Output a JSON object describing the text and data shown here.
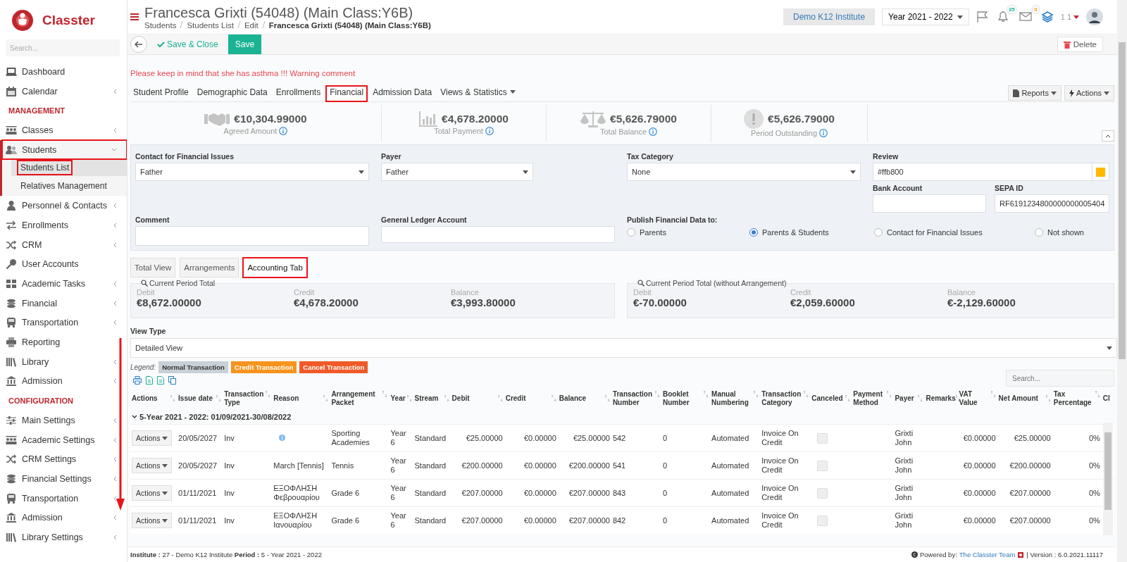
{
  "brand": {
    "name": "Classter"
  },
  "sidebar": {
    "search": {
      "placeholder": "Search..."
    },
    "items": [
      {
        "kind": "link",
        "label": "Dashboard",
        "highlighted": false
      },
      {
        "kind": "group",
        "label": "Calendar",
        "expanded": false,
        "highlighted": false
      },
      {
        "kind": "section",
        "label": "MANAGEMENT"
      },
      {
        "kind": "group",
        "label": "Classes",
        "expanded": false,
        "highlighted": false
      },
      {
        "kind": "group",
        "label": "Students",
        "expanded": true,
        "highlighted": true,
        "children": [
          {
            "label": "Students List",
            "selected": true,
            "highlighted": true
          },
          {
            "label": "Relatives Management",
            "selected": false,
            "highlighted": false
          }
        ]
      },
      {
        "kind": "group",
        "label": "Personnel & Contacts",
        "expanded": false,
        "highlighted": false
      },
      {
        "kind": "group",
        "label": "Enrollments",
        "expanded": false,
        "highlighted": false
      },
      {
        "kind": "group",
        "label": "CRM",
        "expanded": false,
        "highlighted": false
      },
      {
        "kind": "link",
        "label": "User Accounts",
        "highlighted": false
      },
      {
        "kind": "group",
        "label": "Academic Tasks",
        "expanded": false,
        "highlighted": false
      },
      {
        "kind": "group",
        "label": "Financial",
        "expanded": false,
        "highlighted": false
      },
      {
        "kind": "group",
        "label": "Transportation",
        "expanded": false,
        "highlighted": false
      },
      {
        "kind": "link",
        "label": "Reporting",
        "highlighted": false
      },
      {
        "kind": "group",
        "label": "Library",
        "expanded": false,
        "highlighted": false
      },
      {
        "kind": "group",
        "label": "Admission",
        "expanded": false,
        "highlighted": false
      },
      {
        "kind": "section",
        "label": "CONFIGURATION"
      },
      {
        "kind": "group",
        "label": "Main Settings",
        "expanded": false,
        "highlighted": false
      },
      {
        "kind": "group",
        "label": "Academic Settings",
        "expanded": false,
        "highlighted": false
      },
      {
        "kind": "group",
        "label": "CRM Settings",
        "expanded": false,
        "highlighted": false
      },
      {
        "kind": "group",
        "label": "Financial Settings",
        "expanded": false,
        "highlighted": false
      },
      {
        "kind": "group",
        "label": "Transportation",
        "expanded": false,
        "highlighted": false
      },
      {
        "kind": "group",
        "label": "Admission",
        "expanded": false,
        "highlighted": false
      },
      {
        "kind": "group",
        "label": "Library Settings",
        "expanded": false,
        "highlighted": false
      }
    ]
  },
  "header": {
    "title": "Francesca Grixti (54048) (Main Class:Y6B)",
    "breadcrumb": [
      "Students",
      "Students List",
      "Edit",
      "Francesca Grixti (54048) (Main Class:Y6B)"
    ],
    "institute": "Demo K12 Institute",
    "year": "Year 2021 - 2022",
    "notifications": "35",
    "messages": "0",
    "user": "1 1"
  },
  "toolbar": {
    "save_close": "Save & Close",
    "save": "Save",
    "delete": "Delete"
  },
  "warning": "Please keep in mind that she has asthma !!! Warning comment",
  "tabs": [
    {
      "label": "Student Profile",
      "selected": false,
      "highlighted": false
    },
    {
      "label": "Demographic Data",
      "selected": false,
      "highlighted": false
    },
    {
      "label": "Enrollments",
      "selected": false,
      "highlighted": false
    },
    {
      "label": "Financial",
      "selected": true,
      "highlighted": true
    },
    {
      "label": "Admission Data",
      "selected": false,
      "highlighted": false
    },
    {
      "label": "Views & Statistics",
      "selected": false,
      "highlighted": false,
      "dropdown": true
    }
  ],
  "tab_actions": [
    "Reports",
    "Actions"
  ],
  "summary": [
    {
      "amount": "€10,304.99000",
      "label": "Agreed Amount"
    },
    {
      "amount": "€4,678.20000",
      "label": "Total Payment"
    },
    {
      "amount": "€5,626.79000",
      "label": "Total Balance"
    },
    {
      "amount": "€5,626.79000",
      "label": "Period Outstanding"
    }
  ],
  "form": {
    "contact": {
      "label": "Contact for Financial Issues",
      "value": "Father"
    },
    "payer": {
      "label": "Payer",
      "value": "Father"
    },
    "tax_category": {
      "label": "Tax Category",
      "value": "None"
    },
    "review": {
      "label": "Review",
      "value": "#ffb800",
      "color": "#ffb800"
    },
    "bank_account": {
      "label": "Bank Account"
    },
    "sepa_id": {
      "label": "SEPA ID",
      "value": "RF6191234800000000005404"
    },
    "comment": {
      "label": "Comment"
    },
    "general_ledger": {
      "label": "General Ledger Account"
    },
    "publish": {
      "label": "Publish Financial Data to:",
      "options": [
        {
          "label": "Parents",
          "selected": false
        },
        {
          "label": "Parents & Students",
          "selected": true
        },
        {
          "label": "Contact for Financial Issues",
          "selected": false
        },
        {
          "label": "Not shown",
          "selected": false
        }
      ]
    }
  },
  "subtabs": [
    {
      "label": "Total View",
      "selected": false,
      "highlighted": false
    },
    {
      "label": "Arrangements",
      "selected": false,
      "highlighted": false
    },
    {
      "label": "Accounting Tab",
      "selected": true,
      "highlighted": true
    }
  ],
  "totals": [
    {
      "title": "Current Period Total",
      "stats": [
        {
          "label": "Debit",
          "value": "€8,672.00000"
        },
        {
          "label": "Credit",
          "value": "€4,678.20000"
        },
        {
          "label": "Balance",
          "value": "€3,993.80000"
        }
      ]
    },
    {
      "title": "Current Period Total (without Arrangement)",
      "stats": [
        {
          "label": "Debit",
          "value": "€-70.00000"
        },
        {
          "label": "Credit",
          "value": "€2,059.60000"
        },
        {
          "label": "Balance",
          "value": "€-2,129.60000"
        }
      ]
    }
  ],
  "view_type": {
    "label": "View Type",
    "value": "Detailed View"
  },
  "legend": {
    "label": "Legend:",
    "items": [
      {
        "label": "Normal Transaction",
        "color": "#c9d0d6"
      },
      {
        "label": "Credit Transaction",
        "color": "#f7941d"
      },
      {
        "label": "Cancel Transaction",
        "color": "#f05a28"
      }
    ]
  },
  "table": {
    "search": {
      "placeholder": "Search..."
    },
    "columns": [
      "Actions",
      "Issue date",
      "Transaction Type",
      "Reason",
      "Arrangement Packet",
      "Year",
      "Stream",
      "Debit",
      "Credit",
      "Balance",
      "Transaction Number",
      "Booklet Number",
      "Manual Numbering",
      "Transaction Category",
      "Canceled",
      "Payment Method",
      "Payer",
      "Remarks",
      "VAT Value",
      "Net Amount",
      "Tax Percentage",
      "Cl"
    ],
    "group": {
      "label": "5-Year 2021 - 2022: 01/09/2021-30/08/2022",
      "expanded": true
    },
    "rows": [
      {
        "actions": "Actions",
        "issue_date": "20/05/2027",
        "type": "Inv",
        "info": true,
        "packet": "Sporting Academies",
        "year": "Year 6",
        "stream": "Standard",
        "debit": "€25.00000",
        "credit": "€0.00000",
        "balance": "€25.00000",
        "number": "542",
        "booklet": "0",
        "numbering": "Automated",
        "category": "Invoice On Credit",
        "canceled": false,
        "payer": "Grixti John",
        "vat": "€0.00000",
        "net": "€25.00000",
        "tax": "0%"
      },
      {
        "actions": "Actions",
        "issue_date": "20/05/2027",
        "type": "Inv",
        "reason": "March [Tennis]",
        "info": false,
        "packet": "Tennis",
        "year": "Year 6",
        "stream": "Standard",
        "debit": "€200.00000",
        "credit": "€0.00000",
        "balance": "€200.00000",
        "number": "541",
        "booklet": "0",
        "numbering": "Automated",
        "category": "Invoice On Credit",
        "canceled": false,
        "payer": "Grixti John",
        "vat": "€0.00000",
        "net": "€200.00000",
        "tax": "0%"
      },
      {
        "actions": "Actions",
        "issue_date": "01/11/2021",
        "type": "Inv",
        "reason": "ΕΞΟΦΛΗΣΗ Φεβρουαρίου",
        "info": false,
        "packet": "Grade 6",
        "year": "Year 6",
        "stream": "Standard",
        "debit": "€207.00000",
        "credit": "€0.00000",
        "balance": "€207.00000",
        "number": "843",
        "booklet": "0",
        "numbering": "Automated",
        "category": "Invoice On Credit",
        "canceled": false,
        "payer": "Grixti John",
        "vat": "€0.00000",
        "net": "€207.00000",
        "tax": "0%"
      },
      {
        "actions": "Actions",
        "issue_date": "01/11/2021",
        "type": "Inv",
        "reason": "ΕΞΟΦΛΗΣΗ Ιανουαρίου",
        "info": false,
        "packet": "Grade 6",
        "year": "Year 6",
        "stream": "Standard",
        "debit": "€207.00000",
        "credit": "€0.00000",
        "balance": "€207.00000",
        "number": "842",
        "booklet": "0",
        "numbering": "Automated",
        "category": "Invoice On Credit",
        "canceled": false,
        "payer": "Grixti John",
        "vat": "€0.00000",
        "net": "€207.00000",
        "tax": "0%"
      }
    ]
  },
  "footer": {
    "info": "**Institute :** 27 - Demo K12 Institute **Period :** 5 - Year 2021 - 2022",
    "powered": "Powered by:",
    "link": "The Classter Team",
    "version": "| Version : 6.0.2021.11117"
  },
  "annotation_arrow": true
}
